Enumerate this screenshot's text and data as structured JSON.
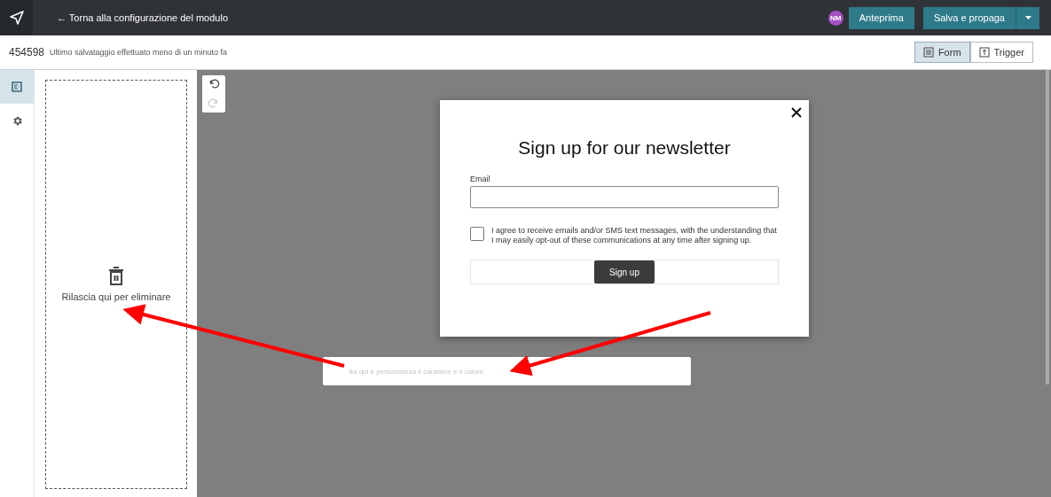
{
  "topbar": {
    "back_link": "← Torna alla configurazione del modulo",
    "avatar": "NM",
    "preview_button": "Anteprima",
    "save_button": "Salva e propaga"
  },
  "subbar": {
    "id": "454598",
    "status": "Ultimo salvataggio effettuato meno di un minuto fa",
    "view_tabs": [
      {
        "label": "Form",
        "selected": true
      },
      {
        "label": "Trigger",
        "selected": false
      }
    ]
  },
  "rail": [
    {
      "kind": "form",
      "selected": true
    },
    {
      "kind": "settings",
      "selected": false
    }
  ],
  "drop_zone": {
    "label": "Rilascia qui per eliminare"
  },
  "history": [
    {
      "kind": "undo",
      "disabled": false
    },
    {
      "kind": "redo",
      "disabled": true
    }
  ],
  "popup": {
    "title": "Sign up for our newsletter",
    "email_label": "Email",
    "consent": {
      "checked": false,
      "text": "I agree to receive emails and/or SMS text messages, with the understanding that I may easily opt-out of these communications at any time after signing up."
    },
    "submit": "Sign up"
  },
  "text_block": {
    "placeholder": "ita qui e personalizza il carattere e il colore"
  }
}
